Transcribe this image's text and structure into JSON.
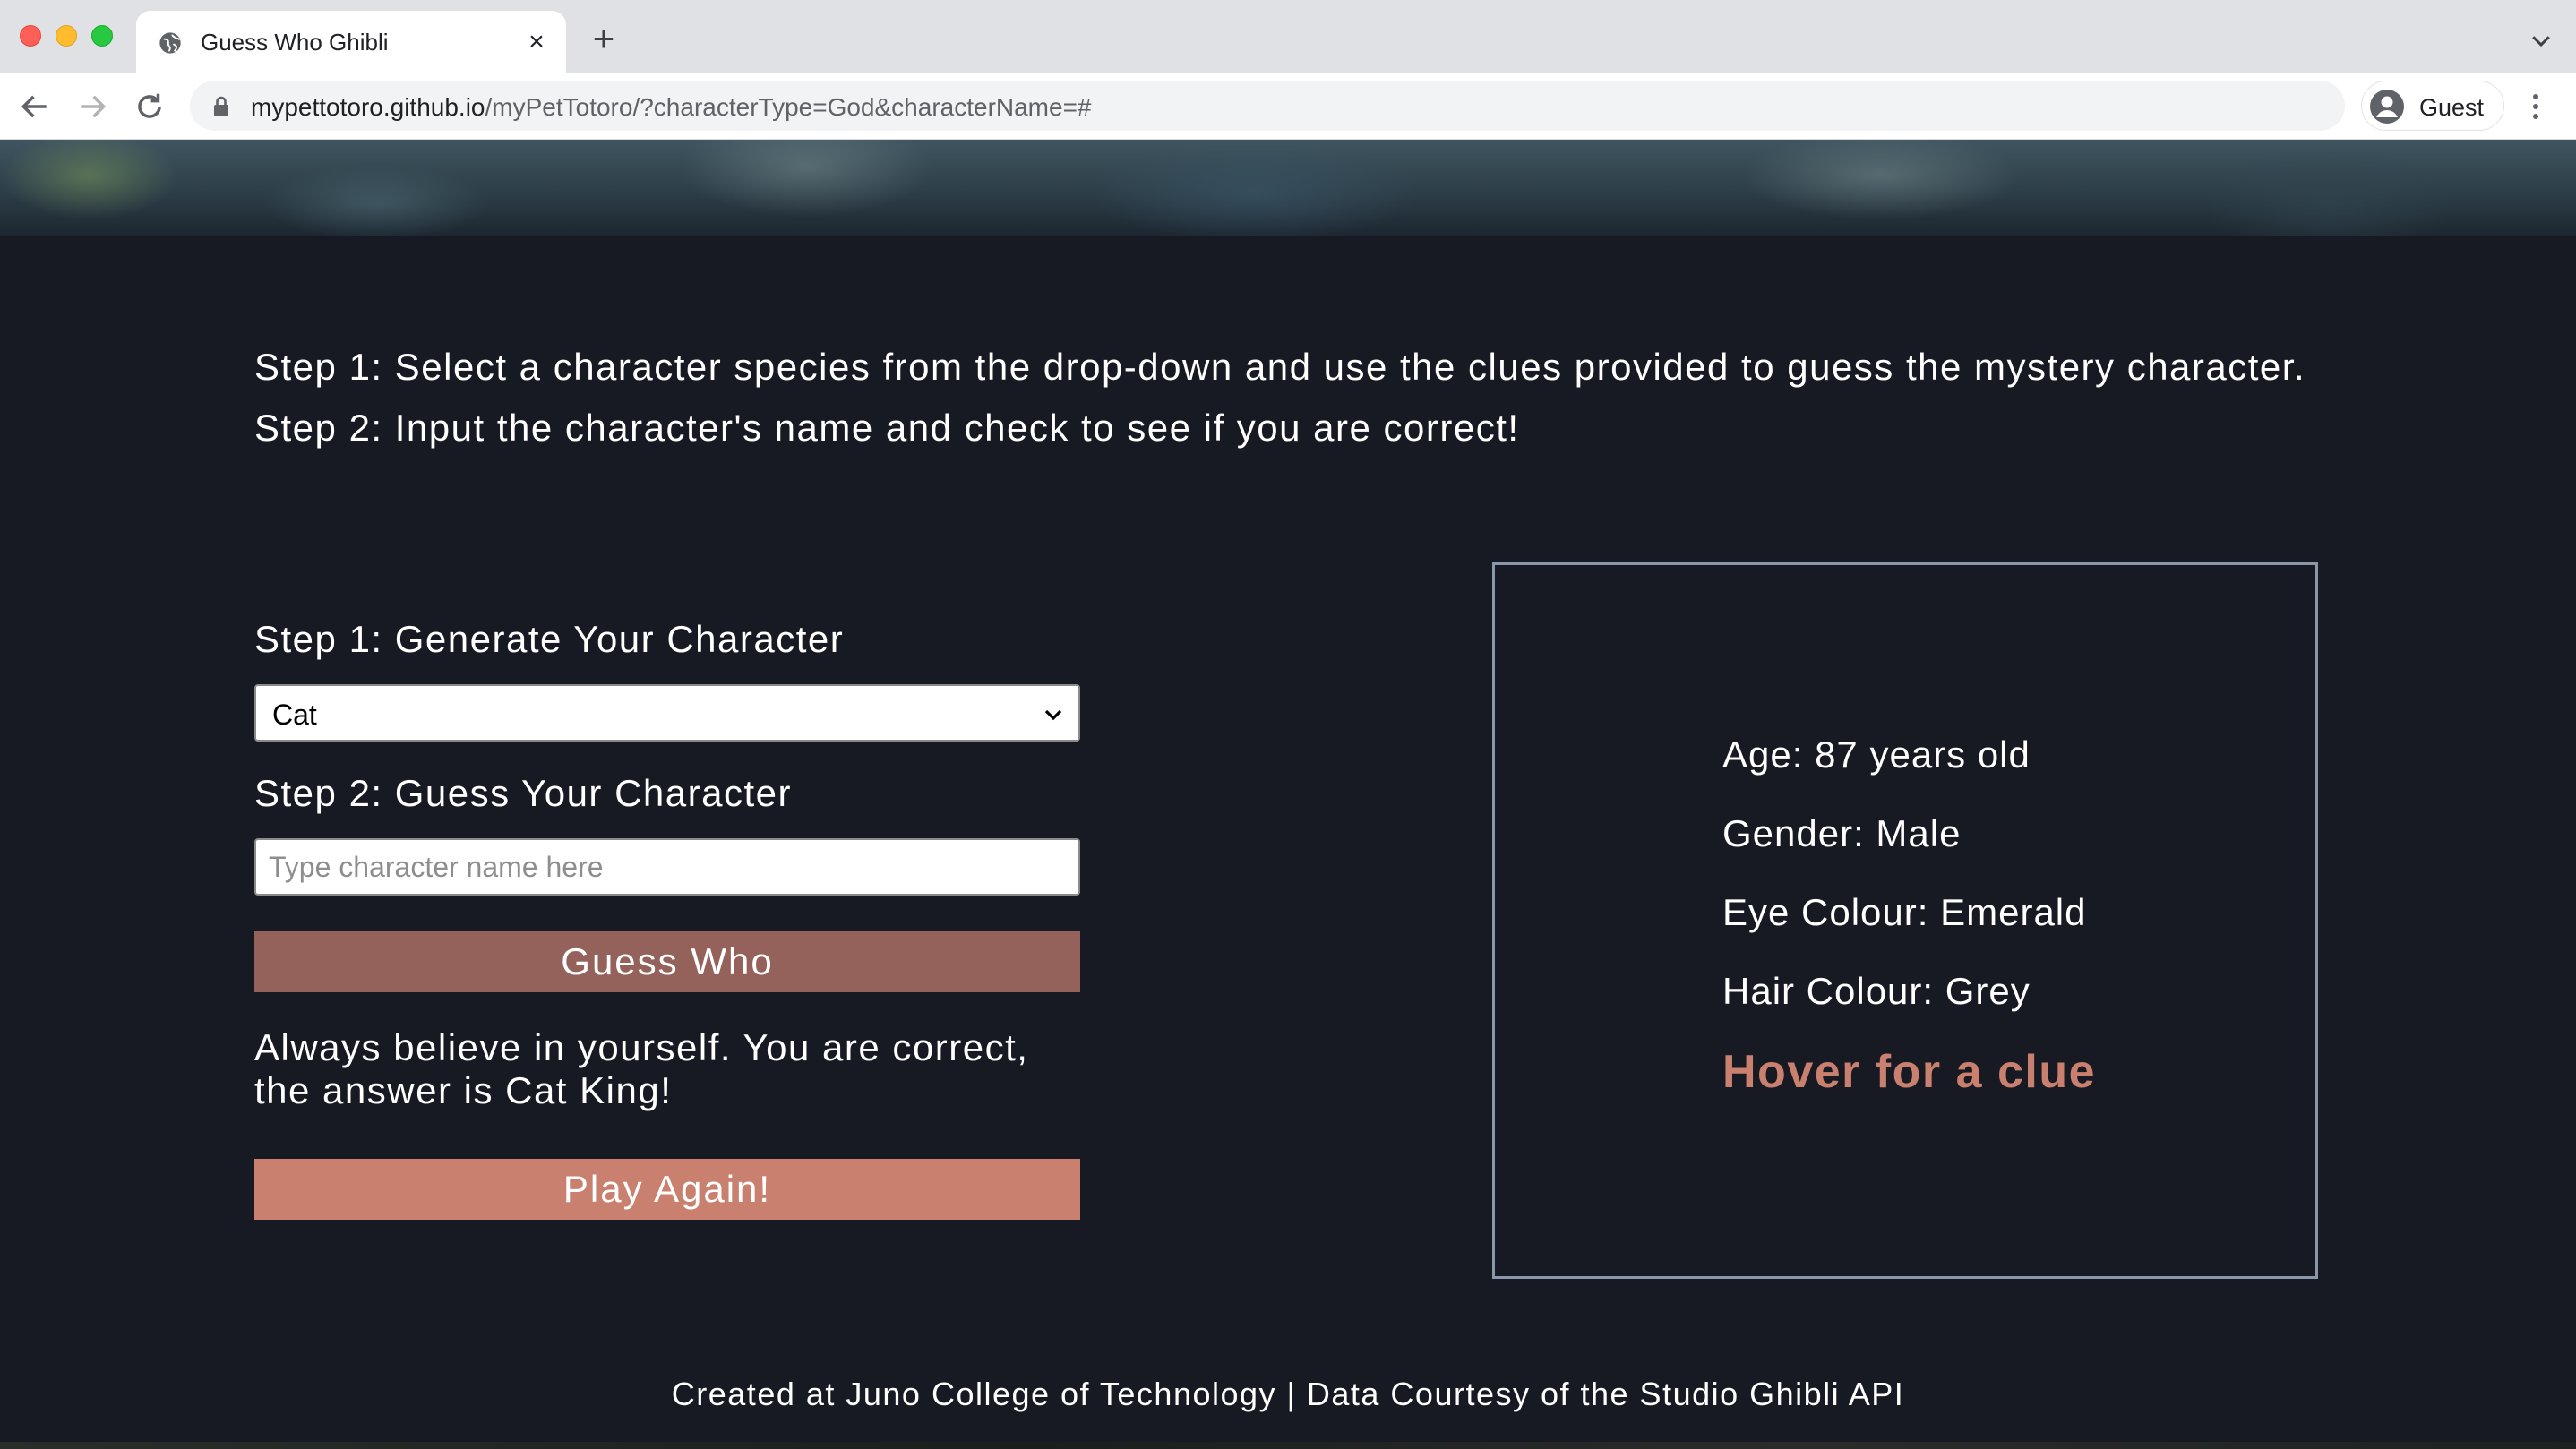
{
  "browser": {
    "tab_title": "Guess Who Ghibli",
    "url_host": "mypettotoro.github.io",
    "url_path": "/myPetTotoro/?characterType=God&characterName=#",
    "profile_label": "Guest"
  },
  "instructions": {
    "line1": "Step 1: Select a character species from the drop-down and use the clues provided to guess the mystery character.",
    "line2": "Step 2: Input the character's name and check to see if you are correct!"
  },
  "form": {
    "step1_heading": "Step 1: Generate Your Character",
    "species_selected": "Cat",
    "step2_heading": "Step 2: Guess Your Character",
    "name_placeholder": "Type character name here",
    "name_value": "",
    "guess_button": "Guess Who",
    "result_message": "Always believe in yourself. You are correct, the answer is Cat King!",
    "play_again_button": "Play Again!"
  },
  "clues": {
    "age": "Age: 87 years old",
    "gender": "Gender: Male",
    "eye_colour": "Eye Colour: Emerald",
    "hair_colour": "Hair Colour: Grey",
    "hover_prompt": "Hover for a clue"
  },
  "footer": {
    "text": "Created at Juno College of Technology | Data Courtesy of the Studio Ghibli API"
  },
  "colors": {
    "page_background": "#171a22",
    "guess_button": "#94625a",
    "play_again_button": "#c9806f",
    "accent_text": "#c9806f",
    "card_border": "#8a97aa"
  }
}
